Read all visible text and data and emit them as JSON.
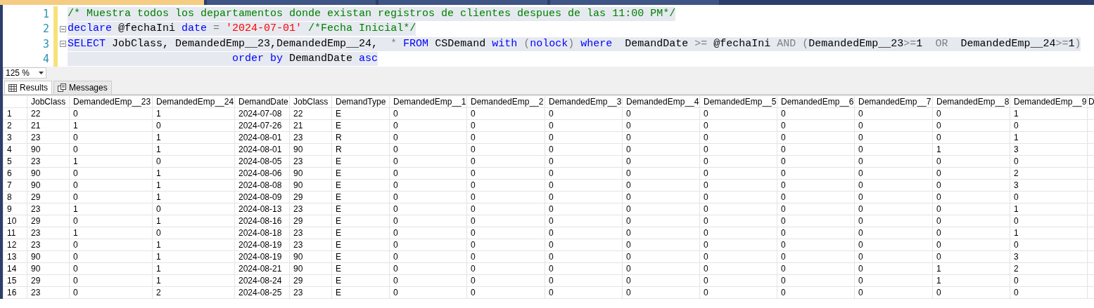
{
  "editor": {
    "lines": [
      {
        "number": "1",
        "collapsible": false,
        "tokens": [
          {
            "kind": "comment",
            "text": "/* Muestra todos los departamentos donde existan registros de clientes despues de las 11:00 PM*/"
          }
        ]
      },
      {
        "number": "2",
        "collapsible": true,
        "tokens": [
          {
            "kind": "keyword",
            "text": "declare"
          },
          {
            "kind": "plain",
            "text": " @fechaIni "
          },
          {
            "kind": "keyword",
            "text": "date"
          },
          {
            "kind": "operator",
            "text": " = "
          },
          {
            "kind": "string",
            "text": "'2024-07-01'"
          },
          {
            "kind": "comment",
            "text": " /*Fecha Inicial*/"
          }
        ]
      },
      {
        "number": "3",
        "collapsible": true,
        "tokens": [
          {
            "kind": "keyword",
            "text": "SELECT"
          },
          {
            "kind": "plain",
            "text": " JobClass, DemandedEmp__23,DemandedEmp__24,  "
          },
          {
            "kind": "operator",
            "text": "*"
          },
          {
            "kind": "keyword",
            "text": " FROM"
          },
          {
            "kind": "plain",
            "text": " CSDemand "
          },
          {
            "kind": "keyword",
            "text": "with"
          },
          {
            "kind": "operator",
            "text": " ("
          },
          {
            "kind": "keyword",
            "text": "nolock"
          },
          {
            "kind": "operator",
            "text": ")"
          },
          {
            "kind": "keyword",
            "text": " where"
          },
          {
            "kind": "plain",
            "text": "  DemandDate "
          },
          {
            "kind": "operator",
            "text": ">="
          },
          {
            "kind": "plain",
            "text": " @fechaIni "
          },
          {
            "kind": "operator",
            "text": "AND ("
          },
          {
            "kind": "plain",
            "text": "DemandedEmp__23"
          },
          {
            "kind": "operator",
            "text": ">="
          },
          {
            "kind": "plain",
            "text": "1  "
          },
          {
            "kind": "operator",
            "text": "OR"
          },
          {
            "kind": "plain",
            "text": "  DemandedEmp__24"
          },
          {
            "kind": "operator",
            "text": ">="
          },
          {
            "kind": "plain",
            "text": "1"
          },
          {
            "kind": "operator",
            "text": ")"
          }
        ]
      },
      {
        "number": "4",
        "collapsible": false,
        "tokens": [
          {
            "kind": "keyword",
            "text": "                          order by"
          },
          {
            "kind": "plain",
            "text": " DemandDate "
          },
          {
            "kind": "keyword",
            "text": "asc"
          }
        ]
      }
    ]
  },
  "zoom": {
    "value": "125 %"
  },
  "document_tabs": [
    {
      "selected": true
    },
    {
      "selected": false
    },
    {
      "selected": false
    },
    {
      "selected": false
    }
  ],
  "result_tabs": [
    {
      "label": "Results",
      "selected": true
    },
    {
      "label": "Messages",
      "selected": false
    }
  ],
  "table": {
    "columns": [
      "JobClass",
      "DemandedEmp__23",
      "DemandedEmp__24",
      "DemandDate",
      "JobClass",
      "DemandType",
      "DemandedEmp__1",
      "DemandedEmp__2",
      "DemandedEmp__3",
      "DemandedEmp__4",
      "DemandedEmp__5",
      "DemandedEmp__6",
      "DemandedEmp__7",
      "DemandedEmp__8",
      "DemandedEmp__9",
      "D"
    ],
    "rows": [
      {
        "number": "1",
        "cells": [
          "22",
          "0",
          "1",
          "2024-07-08",
          "22",
          "E",
          "0",
          "0",
          "0",
          "0",
          "0",
          "0",
          "0",
          "0",
          "1"
        ]
      },
      {
        "number": "2",
        "cells": [
          "21",
          "1",
          "0",
          "2024-07-26",
          "21",
          "E",
          "0",
          "0",
          "0",
          "0",
          "0",
          "0",
          "0",
          "0",
          "0"
        ]
      },
      {
        "number": "3",
        "cells": [
          "23",
          "0",
          "1",
          "2024-08-01",
          "23",
          "R",
          "0",
          "0",
          "0",
          "0",
          "0",
          "0",
          "0",
          "0",
          "1"
        ]
      },
      {
        "number": "4",
        "cells": [
          "90",
          "0",
          "1",
          "2024-08-01",
          "90",
          "R",
          "0",
          "0",
          "0",
          "0",
          "0",
          "0",
          "0",
          "1",
          "3"
        ]
      },
      {
        "number": "5",
        "cells": [
          "23",
          "1",
          "0",
          "2024-08-05",
          "23",
          "E",
          "0",
          "0",
          "0",
          "0",
          "0",
          "0",
          "0",
          "0",
          "0"
        ]
      },
      {
        "number": "6",
        "cells": [
          "90",
          "0",
          "1",
          "2024-08-06",
          "90",
          "E",
          "0",
          "0",
          "0",
          "0",
          "0",
          "0",
          "0",
          "0",
          "2"
        ]
      },
      {
        "number": "7",
        "cells": [
          "90",
          "0",
          "1",
          "2024-08-08",
          "90",
          "E",
          "0",
          "0",
          "0",
          "0",
          "0",
          "0",
          "0",
          "0",
          "3"
        ]
      },
      {
        "number": "8",
        "cells": [
          "29",
          "0",
          "1",
          "2024-08-09",
          "29",
          "E",
          "0",
          "0",
          "0",
          "0",
          "0",
          "0",
          "0",
          "0",
          "0"
        ]
      },
      {
        "number": "9",
        "cells": [
          "23",
          "1",
          "0",
          "2024-08-13",
          "23",
          "E",
          "0",
          "0",
          "0",
          "0",
          "0",
          "0",
          "0",
          "0",
          "1"
        ]
      },
      {
        "number": "10",
        "cells": [
          "29",
          "0",
          "1",
          "2024-08-16",
          "29",
          "E",
          "0",
          "0",
          "0",
          "0",
          "0",
          "0",
          "0",
          "0",
          "0"
        ]
      },
      {
        "number": "11",
        "cells": [
          "23",
          "1",
          "0",
          "2024-08-18",
          "23",
          "E",
          "0",
          "0",
          "0",
          "0",
          "0",
          "0",
          "0",
          "0",
          "1"
        ]
      },
      {
        "number": "12",
        "cells": [
          "23",
          "0",
          "1",
          "2024-08-19",
          "23",
          "E",
          "0",
          "0",
          "0",
          "0",
          "0",
          "0",
          "0",
          "0",
          "0"
        ]
      },
      {
        "number": "13",
        "cells": [
          "90",
          "0",
          "1",
          "2024-08-19",
          "90",
          "E",
          "0",
          "0",
          "0",
          "0",
          "0",
          "0",
          "0",
          "0",
          "3"
        ]
      },
      {
        "number": "14",
        "cells": [
          "90",
          "0",
          "1",
          "2024-08-21",
          "90",
          "E",
          "0",
          "0",
          "0",
          "0",
          "0",
          "0",
          "0",
          "1",
          "2"
        ]
      },
      {
        "number": "15",
        "cells": [
          "29",
          "0",
          "1",
          "2024-08-24",
          "29",
          "E",
          "0",
          "0",
          "0",
          "0",
          "0",
          "0",
          "0",
          "1",
          "0"
        ]
      },
      {
        "number": "16",
        "cells": [
          "23",
          "0",
          "2",
          "2024-08-25",
          "23",
          "E",
          "0",
          "0",
          "0",
          "0",
          "0",
          "0",
          "0",
          "0",
          "0"
        ]
      }
    ]
  }
}
